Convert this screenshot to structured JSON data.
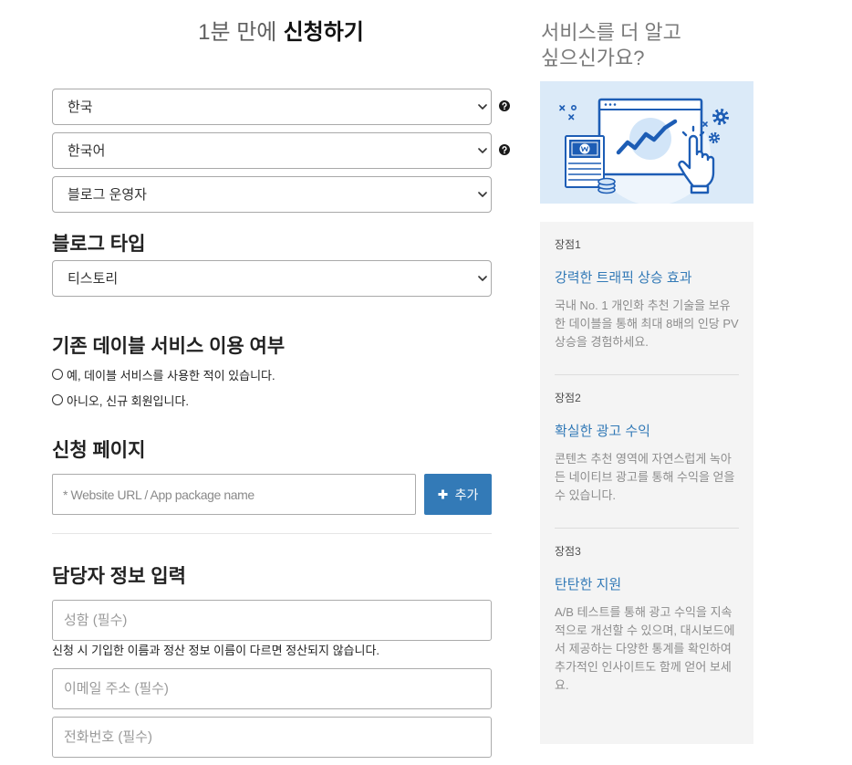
{
  "colors": {
    "accent": "#337ab7",
    "illustration_background": "#dbeaf8",
    "panel_background": "#f4f4f4"
  },
  "form": {
    "title": {
      "prefix": "1분 만에",
      "emphasis": "신청하기"
    },
    "country": {
      "value": "한국",
      "help_icon": "question-circle-icon"
    },
    "language": {
      "value": "한국어",
      "help_icon": "question-circle-icon"
    },
    "role": {
      "value": "블로그 운영자"
    },
    "blog_type": {
      "heading": "블로그 타입",
      "value": "티스토리"
    },
    "existing_service": {
      "heading": "기존 데이블 서비스 이용 여부",
      "options": [
        {
          "label": "예, 데이블 서비스를 사용한 적이 있습니다.",
          "checked": false
        },
        {
          "label": "아니오, 신규 회원입니다.",
          "checked": false
        }
      ]
    },
    "site": {
      "heading": "신청 페이지",
      "url_placeholder": "* Website URL / App package name",
      "add_button": {
        "label": "추가",
        "icon": "plus-icon"
      }
    },
    "contact": {
      "heading": "담당자 정보 입력",
      "name_placeholder": "성함 (필수)",
      "name_notice": "신청 시 기입한 이름과 정산 정보 이름이 다르면 정산되지 않습니다.",
      "email_placeholder": "이메일 주소 (필수)",
      "phone_placeholder": "전화번호 (필수)"
    }
  },
  "sidebar": {
    "heading": "서비스를 더 알고 싶으신가요?",
    "benefits": [
      {
        "label": "장점1",
        "title": "강력한 트래픽 상승 효과",
        "description": "국내 No. 1 개인화 추천 기술을 보유한 데이블을 통해 최대 8배의 인당 PV 상승을 경험하세요."
      },
      {
        "label": "장점2",
        "title": "확실한 광고 수익",
        "description": "콘텐츠 추천 영역에 자연스럽게 녹아든 네이티브 광고를 통해 수익을 얻을 수 있습니다."
      },
      {
        "label": "장점3",
        "title": "탄탄한 지원",
        "description": "A/B 테스트를 통해 광고 수익을 지속적으로 개선할 수 있으며, 대시보드에서 제공하는 다양한 통계를 확인하여 추가적인 인사이트도 함께 얻어 보세요."
      }
    ]
  }
}
